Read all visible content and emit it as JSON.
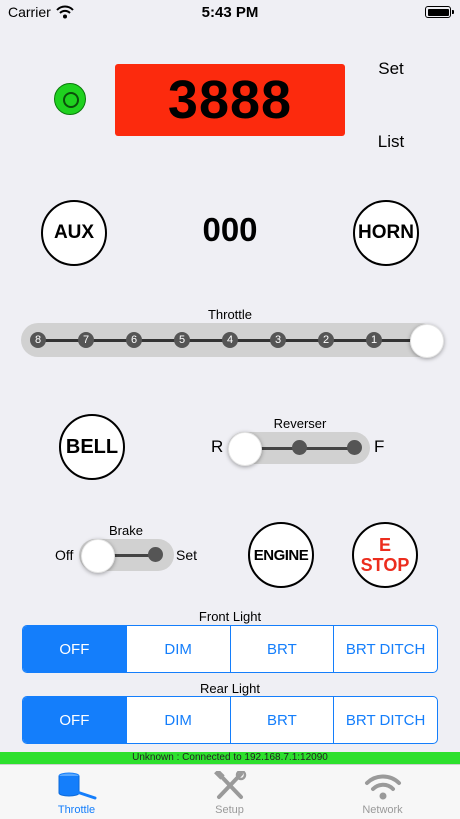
{
  "status_bar": {
    "carrier": "Carrier",
    "time": "5:43 PM"
  },
  "loco": {
    "address": "3888",
    "set_label": "Set",
    "list_label": "List",
    "display_color": "#fc2a0d",
    "status_color": "#1fd11f"
  },
  "functions": {
    "aux_label": "AUX",
    "horn_label": "HORN",
    "bell_label": "BELL",
    "engine_label": "ENGINE",
    "estop_line1": "E",
    "estop_line2": "STOP"
  },
  "speed": {
    "value": "000"
  },
  "throttle": {
    "label": "Throttle",
    "notches": [
      "8",
      "7",
      "6",
      "5",
      "4",
      "3",
      "2",
      "1"
    ],
    "position": 0
  },
  "reverser": {
    "label": "Reverser",
    "left_label": "R",
    "right_label": "F",
    "position": "R"
  },
  "brake": {
    "label": "Brake",
    "off_label": "Off",
    "set_label": "Set",
    "position": "Off"
  },
  "front_light": {
    "label": "Front Light",
    "options": [
      "OFF",
      "DIM",
      "BRT",
      "BRT DITCH"
    ],
    "selected": "OFF"
  },
  "rear_light": {
    "label": "Rear Light",
    "options": [
      "OFF",
      "DIM",
      "BRT",
      "BRT DITCH"
    ],
    "selected": "OFF"
  },
  "connection": {
    "text": "Unknown : Connected to 192.168.7.1:12090",
    "color": "#2de02d"
  },
  "tabs": [
    {
      "label": "Throttle",
      "icon": "throttle-icon",
      "active": true
    },
    {
      "label": "Setup",
      "icon": "tools-icon",
      "active": false
    },
    {
      "label": "Network",
      "icon": "wifi-icon",
      "active": false
    }
  ],
  "accent_color": "#147efb"
}
